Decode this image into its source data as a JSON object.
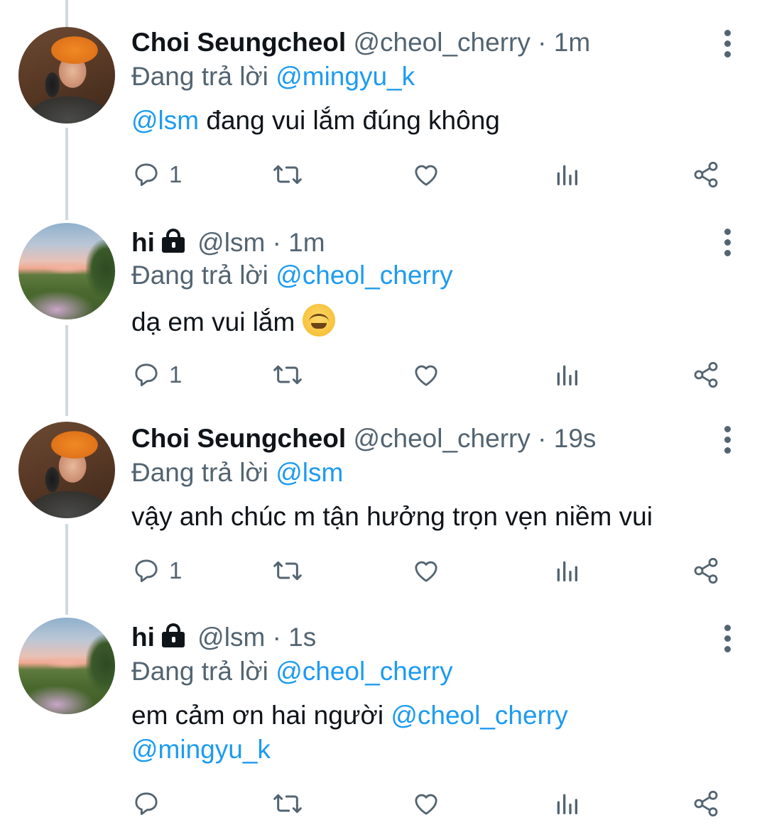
{
  "tweets": [
    {
      "name": "Choi Seungcheol",
      "locked": false,
      "handle": "@cheol_cherry",
      "separator": "·",
      "time": "1m",
      "reply_prefix": "Đang trả lời",
      "reply_to": "@mingyu_k",
      "body_parts": [
        {
          "text": "@lsm",
          "mention": true
        },
        {
          "text": " đang vui lắm đúng không",
          "mention": false
        }
      ],
      "reply_count": "1",
      "avatar": "orange-beanie-selfie"
    },
    {
      "name": "hi",
      "locked": true,
      "handle": "@lsm",
      "separator": "·",
      "time": "1m",
      "reply_prefix": "Đang trả lời",
      "reply_to": "@cheol_cherry",
      "body_parts": [
        {
          "text": "dạ em vui lắm ",
          "mention": false
        }
      ],
      "emoji": "hugging-face-emoji",
      "reply_count": "1",
      "avatar": "sunset-field"
    },
    {
      "name": "Choi Seungcheol",
      "locked": false,
      "handle": "@cheol_cherry",
      "separator": "·",
      "time": "19s",
      "reply_prefix": "Đang trả lời",
      "reply_to": "@lsm",
      "body_parts": [
        {
          "text": "vậy anh chúc m tận hưởng trọn vẹn niềm vui",
          "mention": false
        }
      ],
      "reply_count": "1",
      "avatar": "orange-beanie-selfie"
    },
    {
      "name": "hi",
      "locked": true,
      "handle": "@lsm",
      "separator": "·",
      "time": "1s",
      "reply_prefix": "Đang trả lời",
      "reply_to": "@cheol_cherry",
      "body_parts": [
        {
          "text": "em cảm ơn hai người ",
          "mention": false
        },
        {
          "text": "@cheol_cherry",
          "mention": true
        },
        {
          "text": "@mingyu_k",
          "mention": true,
          "newline": true
        }
      ],
      "reply_count": "",
      "avatar": "sunset-field"
    }
  ],
  "colors": {
    "accent": "#1d9bf0",
    "secondary_text": "#536471",
    "primary_text": "#0f1419",
    "thread_line": "#cfd9de"
  },
  "icons": [
    "reply-icon",
    "retweet-icon",
    "like-icon",
    "views-icon",
    "share-icon",
    "more-icon",
    "lock-icon"
  ]
}
